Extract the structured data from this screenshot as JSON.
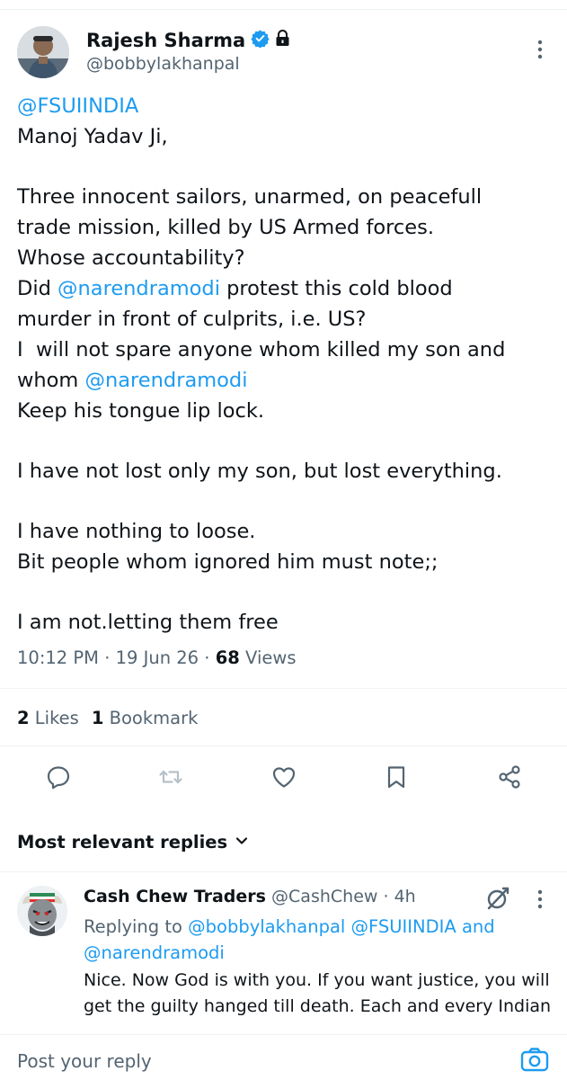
{
  "tweet": {
    "author": {
      "name": "Rajesh Sharma",
      "handle": "@bobbylakhanpal",
      "verified": true,
      "protected": true
    },
    "lines": [
      [
        {
          "text": "@FSUIINDIA",
          "mention": true
        }
      ],
      [
        {
          "text": "Manoj Yadav Ji,"
        }
      ],
      [],
      [
        {
          "text": "Three innocent sailors, unarmed, on peacefull"
        }
      ],
      [
        {
          "text": "trade mission, killed by US Armed forces."
        }
      ],
      [
        {
          "text": "Whose accountability?"
        }
      ],
      [
        {
          "text": "Did "
        },
        {
          "text": "@narendramodi",
          "mention": true
        },
        {
          "text": " protest this cold blood"
        }
      ],
      [
        {
          "text": "murder in front of culprits, i.e. US?"
        }
      ],
      [
        {
          "text": "I  will not spare anyone whom killed my son and"
        }
      ],
      [
        {
          "text": "whom "
        },
        {
          "text": "@narendramodi",
          "mention": true
        }
      ],
      [
        {
          "text": "Keep his tongue lip lock."
        }
      ],
      [],
      [
        {
          "text": "I have not lost only my son, but lost everything."
        }
      ],
      [],
      [
        {
          "text": "I have nothing to loose."
        }
      ],
      [
        {
          "text": "Bit people whom ignored him must note;;"
        }
      ],
      [],
      [
        {
          "text": "I am not.letting them free"
        }
      ]
    ],
    "time": "10:12 PM",
    "date": "19 Jun 26",
    "views_count": "68",
    "views_label": "Views",
    "likes_count": "2",
    "likes_label": "Likes",
    "bookmarks_count": "1",
    "bookmarks_label": "Bookmark"
  },
  "actions": [
    {
      "name": "reply-icon"
    },
    {
      "name": "retweet-icon"
    },
    {
      "name": "like-icon"
    },
    {
      "name": "bookmark-icon"
    },
    {
      "name": "share-icon"
    }
  ],
  "replies": {
    "sort_label": "Most relevant replies"
  },
  "reply": {
    "name": "Cash Chew Traders",
    "handle": "@CashChew",
    "separator": "·",
    "age": "4h",
    "replying_prefix": "Replying to",
    "replying_line1_mentions": "@bobbylakhanpal @FSUIINDIA",
    "replying_and": "and",
    "replying_line2_mentions": "@narendramodi",
    "text_lines": [
      "Nice. Now God is with you. If you want justice, you will",
      "get the guilty hanged till death. Each and every Indian"
    ]
  },
  "composer": {
    "placeholder": "Post your reply"
  },
  "colors": {
    "accent": "#1d9bf0",
    "text": "#0f1419",
    "muted": "#536471",
    "divider": "#eff3f4"
  }
}
